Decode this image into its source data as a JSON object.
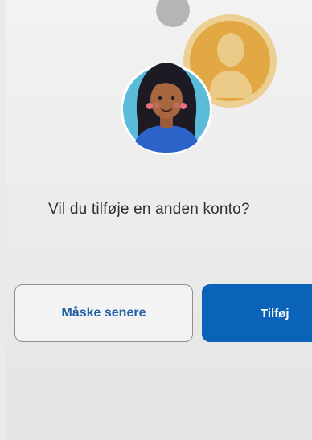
{
  "dialog": {
    "prompt": "Vil du tilføje en anden konto?",
    "later_button": "Måske senere",
    "add_button": "Tilføj"
  },
  "icons": {
    "primary_avatar": "woman-avatar-icon",
    "secondary_avatar": "person-silhouette-icon"
  },
  "colors": {
    "primary_button": "#0a63b8",
    "link_text": "#1f5fa8",
    "avatar_background": "#5bbcd9",
    "secondary_avatar": "#e2a843"
  }
}
